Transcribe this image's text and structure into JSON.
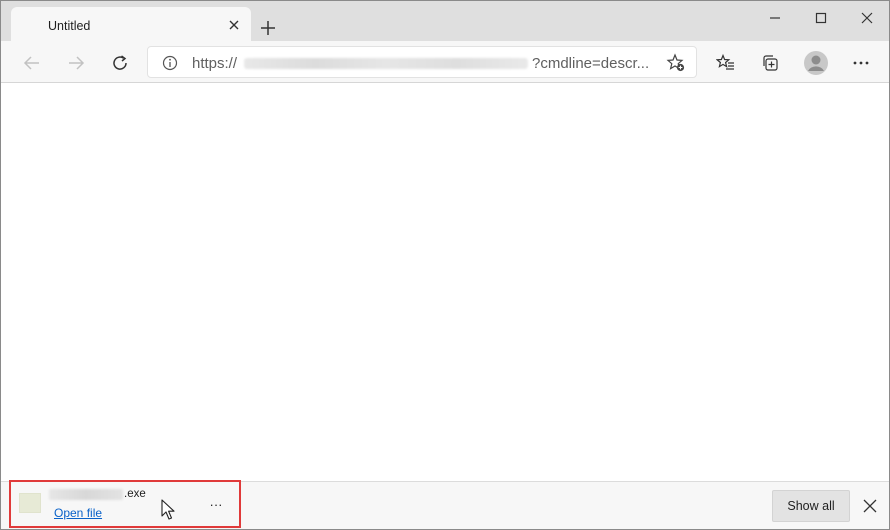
{
  "tab": {
    "title": "Untitled",
    "close_icon": "close-icon",
    "new_tab_icon": "plus-icon"
  },
  "window_controls": {
    "minimize_icon": "minimize-icon",
    "maximize_icon": "maximize-icon",
    "close_icon": "close-icon"
  },
  "toolbar": {
    "back_icon": "arrow-left-icon",
    "forward_icon": "arrow-right-icon",
    "refresh_icon": "refresh-icon",
    "favorites_icon": "favorites-list-icon",
    "collections_icon": "collections-icon",
    "profile_icon": "avatar-icon",
    "menu_icon": "more-horizontal-icon"
  },
  "address_bar": {
    "prefix": "https://",
    "suffix": "?cmdline=descr...",
    "info_icon": "info-icon",
    "add_favorite_icon": "star-add-icon"
  },
  "download_bar": {
    "file_ext": ".exe",
    "open_file_label": "Open file",
    "more_label": "···",
    "show_all_label": "Show all",
    "close_icon": "close-icon",
    "highlight_color": "#e03a3a",
    "link_color": "#0a62c9"
  }
}
